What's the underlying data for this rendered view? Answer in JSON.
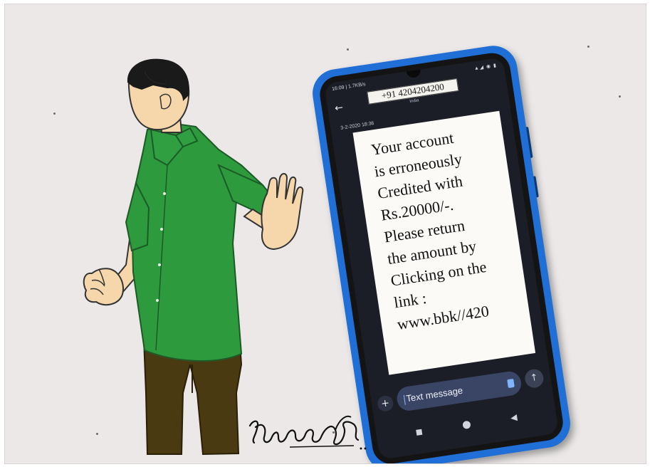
{
  "phone": {
    "status_time": "16:09 | 1.7KB/s",
    "sender_number": "+91 4204204200",
    "sender_region": "India",
    "message_timestamp": "3-2-2020 18:36",
    "message_lines": [
      "Your account",
      "is erroneously",
      "Credited with",
      "Rs.20000/-.",
      "Please return",
      "the amount by",
      "Clicking on the",
      "link :",
      "www.bbk//420"
    ],
    "input_placeholder": "Text message",
    "icons": {
      "back": "arrow-left-icon",
      "plus": "plus-icon",
      "send": "arrow-up-icon",
      "nav_recent": "square-icon",
      "nav_home": "circle-icon",
      "nav_back": "triangle-left-icon"
    }
  },
  "colors": {
    "background": "#ece8e8",
    "phone_case": "#1f6fd6",
    "screen": "#1b1e26",
    "bubble": "#fbfaf7",
    "shirt": "#2e9a3e",
    "pants": "#4a3a12",
    "skin": "#f6d7ac",
    "input_field": "#3a4566"
  }
}
